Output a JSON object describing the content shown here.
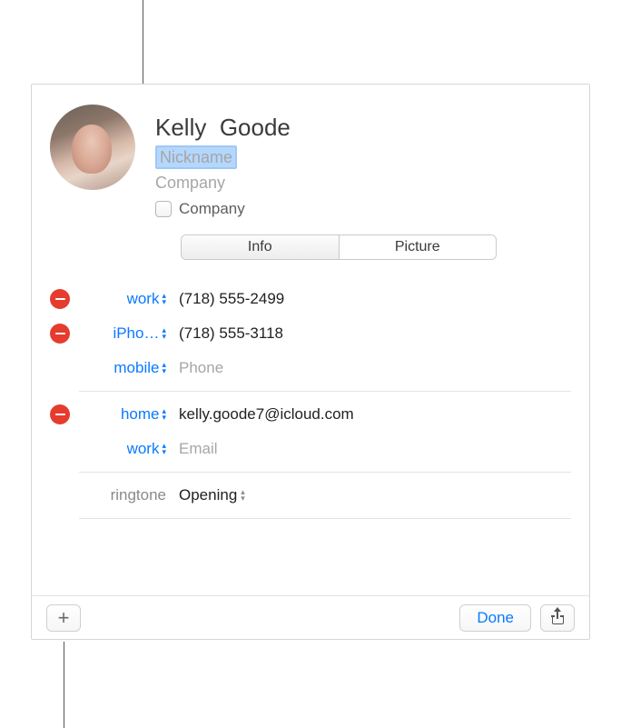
{
  "header": {
    "first_name": "Kelly",
    "last_name": "Goode",
    "nickname_placeholder": "Nickname",
    "company_placeholder": "Company",
    "company_checkbox_label": "Company"
  },
  "tabs": {
    "info": "Info",
    "picture": "Picture"
  },
  "phones": [
    {
      "label": "work",
      "value": "(718) 555-2499",
      "has_remove": true
    },
    {
      "label": "iPho…",
      "value": "(718) 555-3118",
      "has_remove": true
    },
    {
      "label": "mobile",
      "placeholder": "Phone",
      "has_remove": false
    }
  ],
  "emails": [
    {
      "label": "home",
      "value": "kelly.goode7@icloud.com",
      "has_remove": true
    },
    {
      "label": "work",
      "placeholder": "Email",
      "has_remove": false
    }
  ],
  "ringtone": {
    "label": "ringtone",
    "value": "Opening"
  },
  "footer": {
    "done": "Done"
  }
}
